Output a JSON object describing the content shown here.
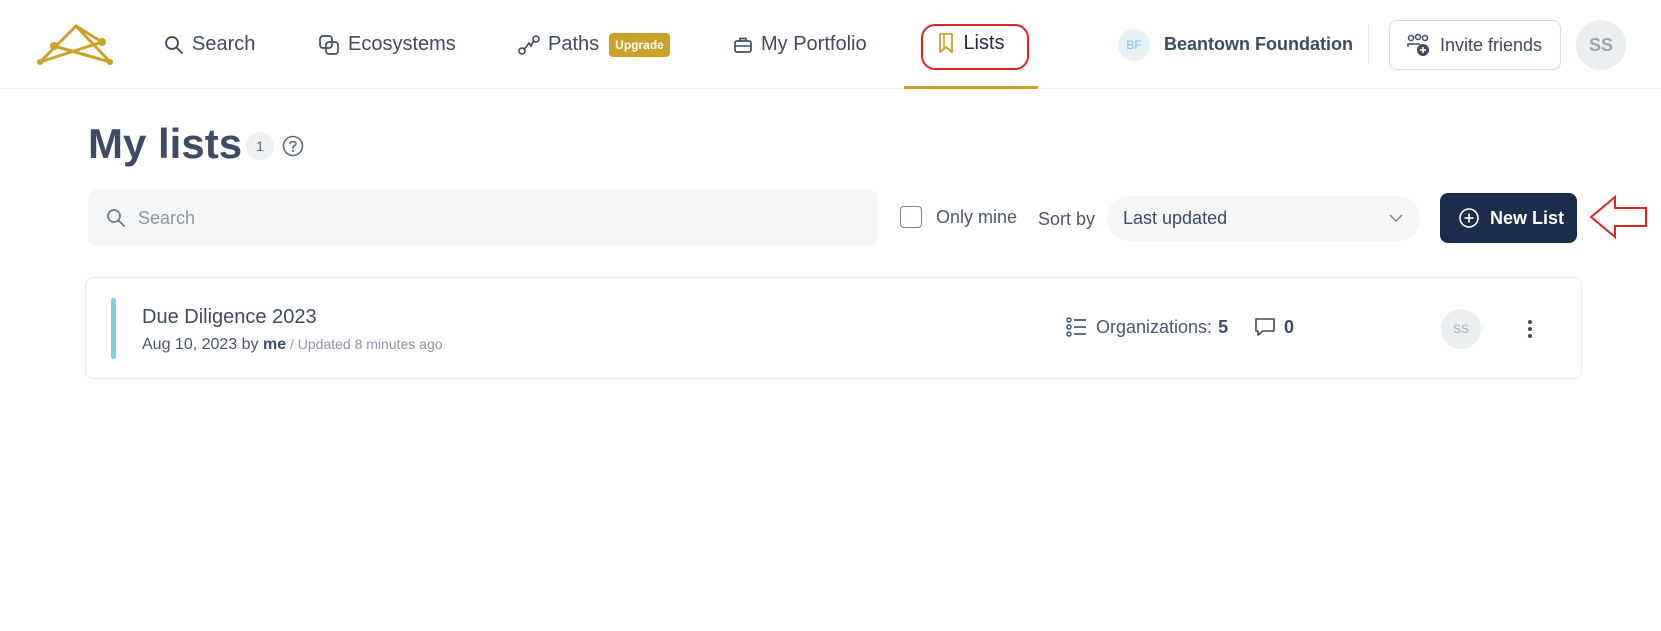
{
  "nav": {
    "search_label": "Search",
    "ecosystems_label": "Ecosystems",
    "paths_label": "Paths",
    "paths_badge": "Upgrade",
    "portfolio_label": "My Portfolio",
    "lists_label": "Lists",
    "org_initials": "BF",
    "org_name": "Beantown Foundation",
    "invite_label": "Invite friends",
    "user_initials": "SS"
  },
  "page": {
    "title": "My lists",
    "count": "1"
  },
  "toolbar": {
    "search_placeholder": "Search",
    "only_mine_label": "Only mine",
    "sort_label": "Sort by",
    "sort_value": "Last updated",
    "new_list_label": "New List"
  },
  "lists": [
    {
      "name": "Due Diligence 2023",
      "date": "Aug 10, 2023 by ",
      "owner": "me",
      "updated": " / Updated 8 minutes ago",
      "organizations_label": "Organizations:",
      "organizations_count": "5",
      "comments_count": "0",
      "owner_initials": "SS"
    }
  ],
  "colors": {
    "accent_gold": "#c9a227",
    "primary_navy": "#1b2d4d",
    "list_accent": "#7ccfdb",
    "annotation_red": "#e02424"
  }
}
